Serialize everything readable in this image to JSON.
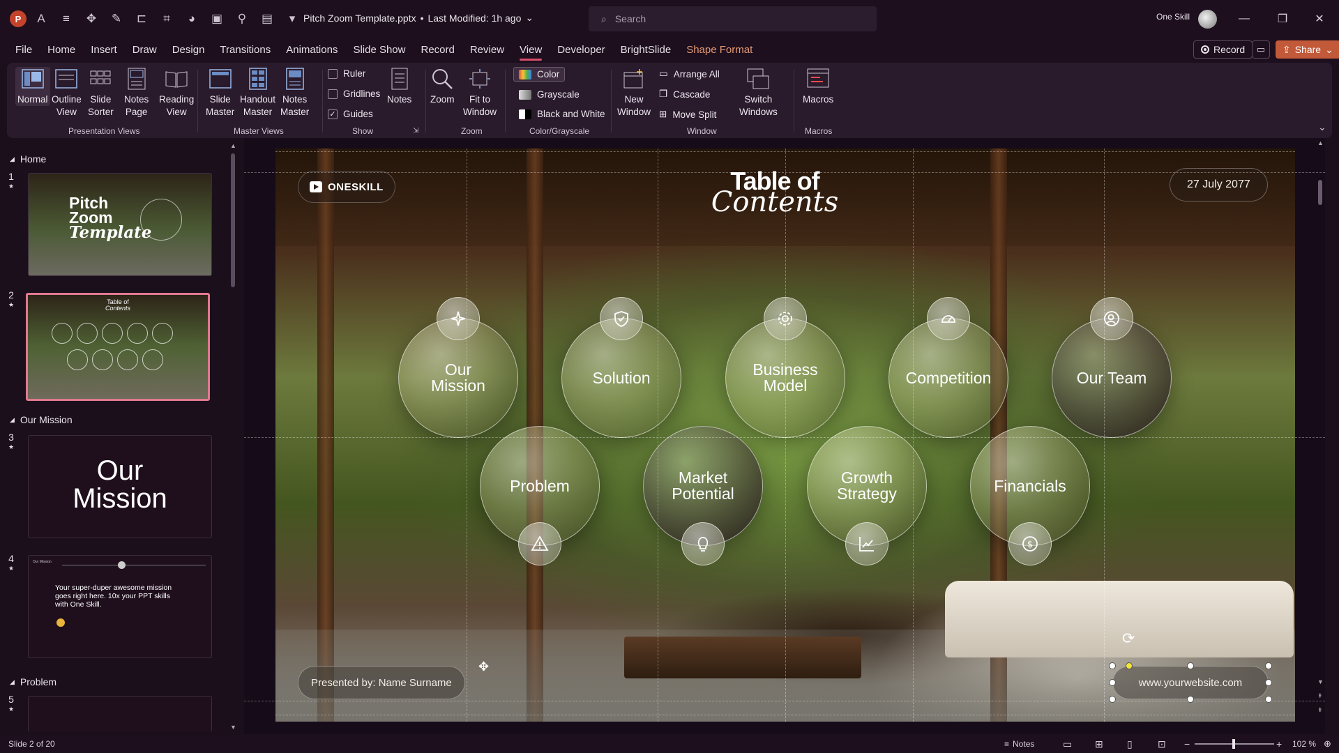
{
  "titlebar": {
    "document_name": "Pitch Zoom Template.pptx",
    "separator": "•",
    "modified": "Last Modified: 1h ago",
    "search_placeholder": "Search",
    "user_name": "One Skill",
    "app_letter": "P"
  },
  "menu": {
    "tabs": [
      "File",
      "Home",
      "Insert",
      "Draw",
      "Design",
      "Transitions",
      "Animations",
      "Slide Show",
      "Record",
      "Review",
      "View",
      "Developer",
      "BrightSlide",
      "Shape Format"
    ],
    "active_tab": "View",
    "record_label": "Record",
    "share_label": "Share"
  },
  "ribbon": {
    "presentation_views": {
      "group_label": "Presentation Views",
      "normal": "Normal",
      "outline_1": "Outline",
      "outline_2": "View",
      "sorter_1": "Slide",
      "sorter_2": "Sorter",
      "notes_page_1": "Notes",
      "notes_page_2": "Page",
      "reading_1": "Reading",
      "reading_2": "View"
    },
    "master_views": {
      "group_label": "Master Views",
      "slide_1": "Slide",
      "slide_2": "Master",
      "handout_1": "Handout",
      "handout_2": "Master",
      "notes_1": "Notes",
      "notes_2": "Master"
    },
    "show": {
      "group_label": "Show",
      "ruler": "Ruler",
      "ruler_checked": false,
      "gridlines": "Gridlines",
      "gridlines_checked": false,
      "guides": "Guides",
      "guides_checked": true,
      "notes": "Notes"
    },
    "zoom": {
      "group_label": "Zoom",
      "zoom": "Zoom",
      "fit_1": "Fit to",
      "fit_2": "Window"
    },
    "color": {
      "group_label": "Color/Grayscale",
      "color": "Color",
      "grayscale": "Grayscale",
      "bw": "Black and White"
    },
    "window": {
      "group_label": "Window",
      "new_1": "New",
      "new_2": "Window",
      "arrange_all": "Arrange All",
      "cascade": "Cascade",
      "move_split": "Move Split",
      "switch_1": "Switch",
      "switch_2": "Windows"
    },
    "macros": {
      "group_label": "Macros",
      "macros": "Macros"
    }
  },
  "thumbnails": {
    "sections": [
      "Home",
      "Our Mission",
      "Problem"
    ],
    "slides": [
      {
        "num": "1",
        "title_1": "Pitch",
        "title_2": "Zoom",
        "title_3": "Template"
      },
      {
        "num": "2",
        "title_1": "Table of",
        "title_2": "Contents"
      },
      {
        "num": "3",
        "title_1": "Our",
        "title_2": "Mission"
      },
      {
        "num": "4",
        "heading": "Our Mission",
        "body": "Your super-duper awesome mission goes right here. 10x your PPT skills with One Skill."
      },
      {
        "num": "5"
      }
    ]
  },
  "slide": {
    "brand": "ONESKILL",
    "title_line1": "Table of",
    "title_line2": "Contents",
    "date": "27 July 2077",
    "topics": [
      {
        "label_1": "Our",
        "label_2": "Mission",
        "icon": "sparkle-icon"
      },
      {
        "label_1": "Solution",
        "label_2": "",
        "icon": "shield-check-icon"
      },
      {
        "label_1": "Business",
        "label_2": "Model",
        "icon": "gear-icon"
      },
      {
        "label_1": "Competition",
        "label_2": "",
        "icon": "speedometer-icon"
      },
      {
        "label_1": "Our Team",
        "label_2": "",
        "icon": "user-check-icon"
      },
      {
        "label_1": "Problem",
        "label_2": "",
        "icon": "warning-icon"
      },
      {
        "label_1": "Market",
        "label_2": "Potential",
        "icon": "lightbulb-icon"
      },
      {
        "label_1": "Growth",
        "label_2": "Strategy",
        "icon": "trend-chart-icon"
      },
      {
        "label_1": "Financials",
        "label_2": "",
        "icon": "dollar-coin-icon"
      }
    ],
    "presenter": "Presented by: Name Surname",
    "website": "www.yourwebsite.com"
  },
  "status": {
    "slide_counter": "Slide 2 of 20",
    "notes": "Notes",
    "zoom": "102 %"
  },
  "colors": {
    "accent": "#d9506b",
    "share": "#c25a3a",
    "selection": "#e1798f",
    "background": "#1b0f1c"
  }
}
